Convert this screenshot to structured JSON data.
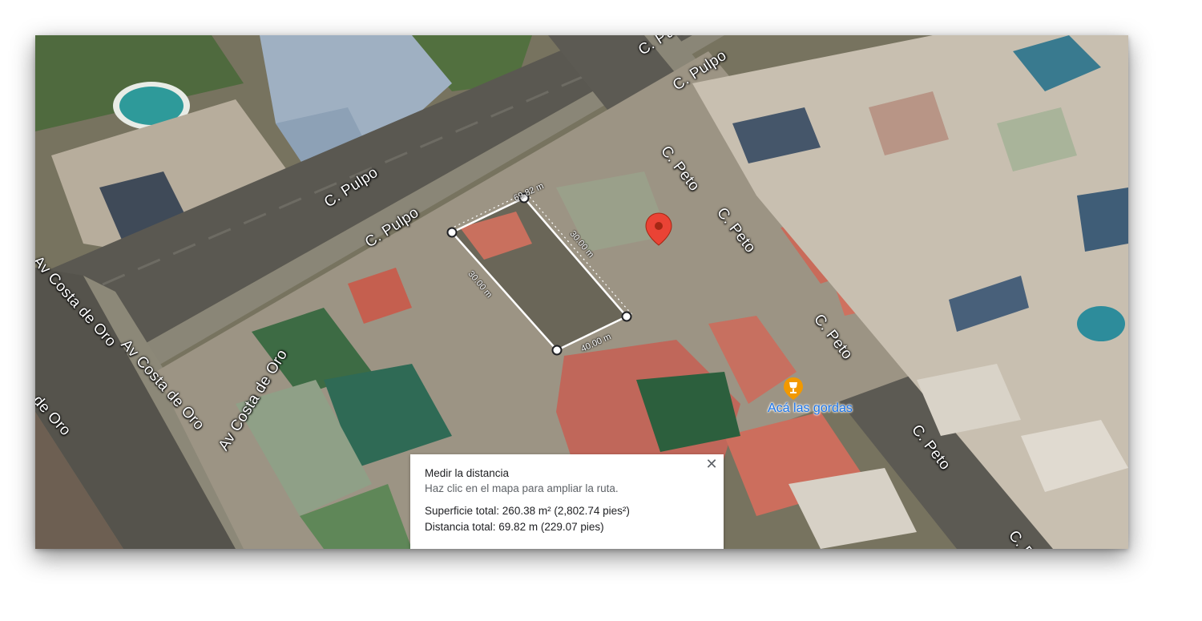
{
  "map": {
    "streets": [
      {
        "id": "pulpo-top",
        "name": "C. Pulpo"
      },
      {
        "id": "pulpo-upper",
        "name": "C. Pulpo"
      },
      {
        "id": "pulpo-mid",
        "name": "C. Pulpo"
      },
      {
        "id": "pulpo-lower",
        "name": "C. Pulpo"
      },
      {
        "id": "peto-1",
        "name": "C. Peto"
      },
      {
        "id": "peto-2",
        "name": "C. Peto"
      },
      {
        "id": "peto-3",
        "name": "C. Peto"
      },
      {
        "id": "peto-4",
        "name": "C. Peto"
      },
      {
        "id": "peto-5",
        "name": "C. Peto"
      },
      {
        "id": "costa-1",
        "name": "Av Costa de Oro"
      },
      {
        "id": "costa-2",
        "name": "Av Costa de Oro"
      },
      {
        "id": "costa-3",
        "name": "Av Costa de Oro"
      },
      {
        "id": "costa-4",
        "name": "de Oro"
      }
    ],
    "measure_segments": [
      {
        "id": "seg-top",
        "label": "69.82 m"
      },
      {
        "id": "seg-right",
        "label": "30.00 m"
      },
      {
        "id": "seg-left",
        "label": "30.00 m"
      },
      {
        "id": "seg-bottom",
        "label": "40.00 m"
      }
    ],
    "poi": {
      "name": "Acá las gordas",
      "icon": "trophy-icon",
      "color": "#f29900"
    },
    "marker": {
      "icon": "map-pin-icon",
      "color": "#ea4335"
    }
  },
  "info": {
    "title": "Medir la distancia",
    "subtitle": "Haz clic en el mapa para ampliar la ruta.",
    "area": "Superficie total: 260.38 m² (2,802.74 pies²)",
    "distance": "Distancia total: 69.82 m (229.07 pies)",
    "close_icon": "close-icon"
  }
}
